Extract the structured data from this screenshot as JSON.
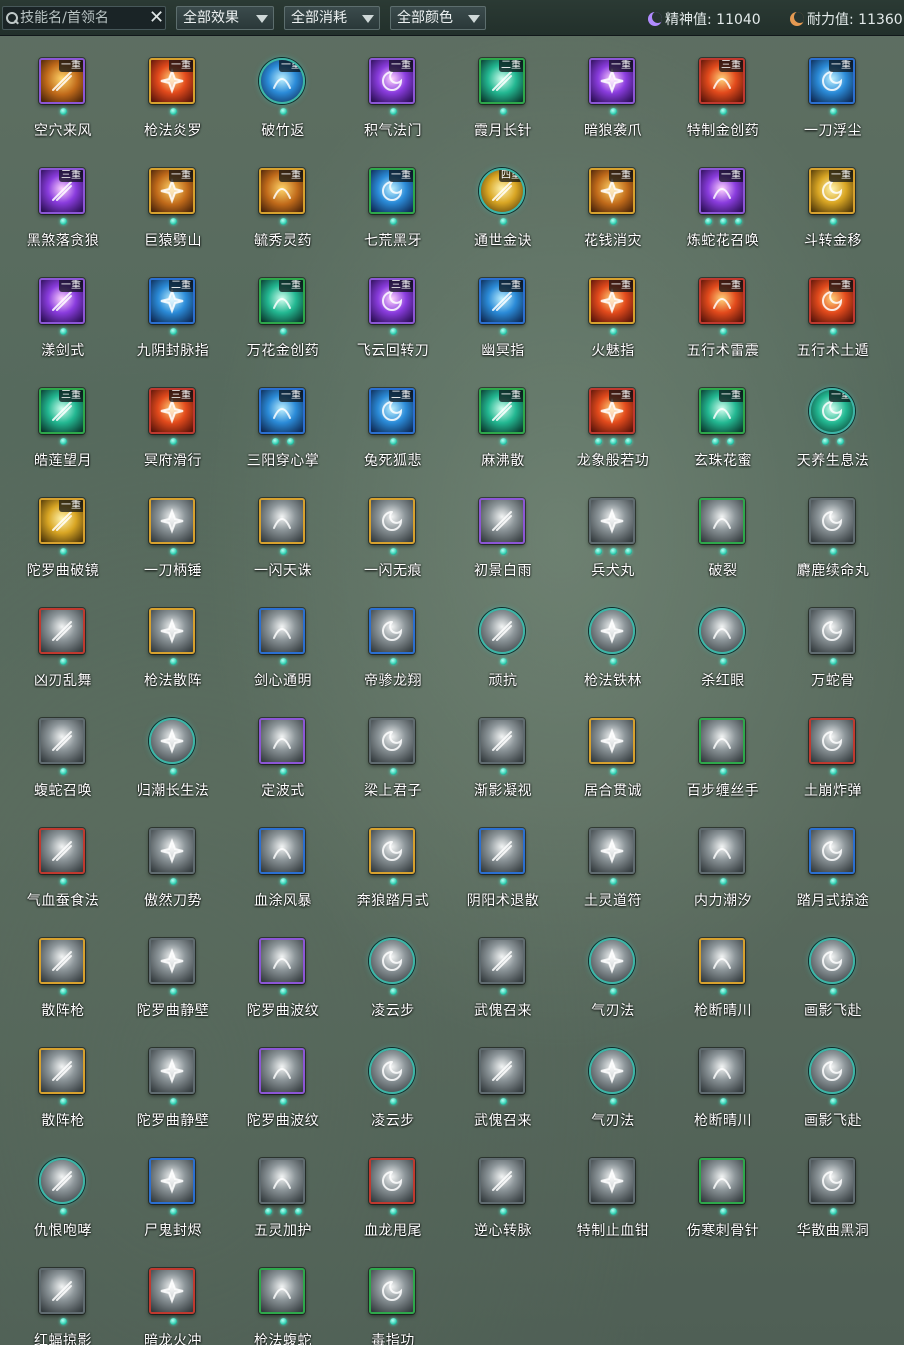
{
  "filter_bar": {
    "search_placeholder": "技能名/首领名",
    "effect_select": "全部效果",
    "cost_select": "全部消耗",
    "color_select": "全部颜色",
    "spirit": "精神值: 11040",
    "stamina": "耐力值: 11360"
  },
  "colors": {
    "purple": "#8c56d6",
    "gold": "#d7a12e",
    "green": "#2ea84b",
    "blue": "#2b6fd1",
    "red": "#c0392f",
    "gray": "#606b70",
    "teal": "#3cb6a8"
  },
  "skills": [
    {
      "name": "空穴来风",
      "tier": "一重",
      "frame": "purple",
      "dots": 1,
      "tone": "warm",
      "icon": "coin-icon"
    },
    {
      "name": "枪法炎罗",
      "tier": "一重",
      "frame": "gold",
      "dots": 1,
      "tone": "fire",
      "icon": "spear-icon"
    },
    {
      "name": "破竹返",
      "tier": "一重",
      "frame": "round",
      "dots": 1,
      "tone": "blue",
      "icon": "bamboo-icon"
    },
    {
      "name": "积气法门",
      "tier": "一重",
      "frame": "purple",
      "dots": 1,
      "tone": "violet",
      "icon": "qi-icon"
    },
    {
      "name": "霞月长针",
      "tier": "二重",
      "frame": "green",
      "dots": 1,
      "tone": "teal",
      "icon": "needle-icon"
    },
    {
      "name": "暗狼袭爪",
      "tier": "一重",
      "frame": "purple",
      "dots": 1,
      "tone": "violet",
      "icon": "claw-icon"
    },
    {
      "name": "特制金创药",
      "tier": "三重",
      "frame": "red",
      "dots": 1,
      "tone": "fire",
      "icon": "potion-icon"
    },
    {
      "name": "一刀浮尘",
      "tier": "一重",
      "frame": "blue",
      "dots": 1,
      "tone": "blue",
      "icon": "blade-icon"
    },
    {
      "name": "黑煞落贪狼",
      "tier": "三重",
      "frame": "purple",
      "dots": 1,
      "tone": "violet",
      "icon": "wolf-icon"
    },
    {
      "name": "巨猿劈山",
      "tier": "一重",
      "frame": "gold",
      "dots": 1,
      "tone": "warm",
      "icon": "ape-icon"
    },
    {
      "name": "毓秀灵药",
      "tier": "一重",
      "frame": "gold",
      "dots": 1,
      "tone": "warm",
      "icon": "gourd-icon"
    },
    {
      "name": "七荒黑牙",
      "tier": "一重",
      "frame": "green",
      "dots": 1,
      "tone": "blue",
      "icon": "fang-icon"
    },
    {
      "name": "通世金诀",
      "tier": "四重",
      "frame": "round",
      "dots": 1,
      "tone": "gold",
      "icon": "scroll-icon"
    },
    {
      "name": "花钱消灾",
      "tier": "一重",
      "frame": "gold",
      "dots": 1,
      "tone": "warm",
      "icon": "pouch-icon"
    },
    {
      "name": "炼蛇花召唤",
      "tier": "一重",
      "frame": "purple",
      "dots": 3,
      "tone": "violet",
      "icon": "serpent-icon"
    },
    {
      "name": "斗转金移",
      "tier": "一重",
      "frame": "gold",
      "dots": 1,
      "tone": "gold",
      "icon": "gold-coin-icon"
    },
    {
      "name": "漾剑式",
      "tier": "一重",
      "frame": "purple",
      "dots": 1,
      "tone": "violet",
      "icon": "sword-icon"
    },
    {
      "name": "九阴封脉指",
      "tier": "二重",
      "frame": "blue",
      "dots": 1,
      "tone": "blue",
      "icon": "finger-icon"
    },
    {
      "name": "万花金创药",
      "tier": "一重",
      "frame": "green",
      "dots": 1,
      "tone": "teal",
      "icon": "herb-icon"
    },
    {
      "name": "飞云回转刀",
      "tier": "三重",
      "frame": "purple",
      "dots": 1,
      "tone": "violet",
      "icon": "saber-icon"
    },
    {
      "name": "幽冥指",
      "tier": "一重",
      "frame": "blue",
      "dots": 1,
      "tone": "blue",
      "icon": "finger-icon"
    },
    {
      "name": "火魅指",
      "tier": "一重",
      "frame": "gold",
      "dots": 1,
      "tone": "fire",
      "icon": "fire-finger-icon"
    },
    {
      "name": "五行术雷震",
      "tier": "一重",
      "frame": "red",
      "dots": 1,
      "tone": "fire",
      "icon": "thunder-icon"
    },
    {
      "name": "五行术土遁",
      "tier": "一重",
      "frame": "red",
      "dots": 1,
      "tone": "fire",
      "icon": "earth-icon"
    },
    {
      "name": "皓莲望月",
      "tier": "三重",
      "frame": "green",
      "dots": 1,
      "tone": "teal",
      "icon": "moon-icon"
    },
    {
      "name": "冥府滑行",
      "tier": "三重",
      "frame": "red",
      "dots": 1,
      "tone": "fire",
      "icon": "dash-icon"
    },
    {
      "name": "三阳穿心掌",
      "tier": "一重",
      "frame": "blue",
      "dots": 2,
      "tone": "blue",
      "icon": "palm-icon"
    },
    {
      "name": "兔死狐悲",
      "tier": "二重",
      "frame": "blue",
      "dots": 1,
      "tone": "blue",
      "icon": "fox-icon"
    },
    {
      "name": "麻沸散",
      "tier": "一重",
      "frame": "green",
      "dots": 1,
      "tone": "teal",
      "icon": "powder-icon"
    },
    {
      "name": "龙象般若功",
      "tier": "一重",
      "frame": "red",
      "dots": 3,
      "tone": "fire",
      "icon": "dragon-icon"
    },
    {
      "name": "玄珠花蜜",
      "tier": "一重",
      "frame": "green",
      "dots": 2,
      "tone": "teal",
      "icon": "flower-icon"
    },
    {
      "name": "天养生息法",
      "tier": "一重",
      "frame": "round",
      "dots": 2,
      "tone": "teal",
      "icon": "lotus-icon"
    },
    {
      "name": "陀罗曲破镜",
      "tier": "一重",
      "frame": "gold",
      "dots": 1,
      "tone": "gold",
      "icon": "mirror-icon"
    },
    {
      "name": "一刀柄锤",
      "tier": "",
      "frame": "gold",
      "dots": 1,
      "tone": "gray",
      "icon": "hammer-icon"
    },
    {
      "name": "一闪天诛",
      "tier": "",
      "frame": "gold",
      "dots": 1,
      "tone": "gray",
      "icon": "slash-icon"
    },
    {
      "name": "一闪无痕",
      "tier": "",
      "frame": "gold",
      "dots": 1,
      "tone": "gray",
      "icon": "slash-icon"
    },
    {
      "name": "初景白雨",
      "tier": "",
      "frame": "purple",
      "dots": 1,
      "tone": "gray",
      "icon": "rain-icon"
    },
    {
      "name": "兵犬丸",
      "tier": "",
      "frame": "gray",
      "dots": 3,
      "tone": "gray",
      "icon": "pill-icon"
    },
    {
      "name": "破裂",
      "tier": "",
      "frame": "green",
      "dots": 1,
      "tone": "gray",
      "icon": "crack-icon"
    },
    {
      "name": "麝鹿续命丸",
      "tier": "",
      "frame": "gray",
      "dots": 1,
      "tone": "gray",
      "icon": "pill-icon"
    },
    {
      "name": "凶刃乱舞",
      "tier": "",
      "frame": "red",
      "dots": 1,
      "tone": "gray",
      "icon": "blade-dance-icon"
    },
    {
      "name": "枪法散阵",
      "tier": "",
      "frame": "gold",
      "dots": 1,
      "tone": "gray",
      "icon": "spear-icon"
    },
    {
      "name": "剑心通明",
      "tier": "",
      "frame": "blue",
      "dots": 1,
      "tone": "gray",
      "icon": "sword-icon"
    },
    {
      "name": "帝骖龙翔",
      "tier": "",
      "frame": "blue",
      "dots": 1,
      "tone": "gray",
      "icon": "dragon-icon"
    },
    {
      "name": "顽抗",
      "tier": "",
      "frame": "round",
      "dots": 1,
      "tone": "gray",
      "icon": "shield-icon"
    },
    {
      "name": "枪法铁林",
      "tier": "",
      "frame": "round",
      "dots": 1,
      "tone": "gray",
      "icon": "spear-icon"
    },
    {
      "name": "杀红眼",
      "tier": "",
      "frame": "round",
      "dots": 1,
      "tone": "gray",
      "icon": "warrior-icon"
    },
    {
      "name": "万蛇骨",
      "tier": "",
      "frame": "gray",
      "dots": 1,
      "tone": "gray",
      "icon": "serpent-icon"
    },
    {
      "name": "蝮蛇召唤",
      "tier": "",
      "frame": "gray",
      "dots": 1,
      "tone": "gray",
      "icon": "serpent-icon"
    },
    {
      "name": "归潮长生法",
      "tier": "",
      "frame": "round",
      "dots": 1,
      "tone": "gray",
      "icon": "tide-icon"
    },
    {
      "name": "定波式",
      "tier": "",
      "frame": "purple",
      "dots": 1,
      "tone": "gray",
      "icon": "wave-icon"
    },
    {
      "name": "梁上君子",
      "tier": "",
      "frame": "gray",
      "dots": 1,
      "tone": "gray",
      "icon": "thief-icon"
    },
    {
      "name": "渐影凝视",
      "tier": "",
      "frame": "gray",
      "dots": 1,
      "tone": "gray",
      "icon": "eye-icon"
    },
    {
      "name": "居合贯诚",
      "tier": "",
      "frame": "gold",
      "dots": 1,
      "tone": "gray",
      "icon": "iai-icon"
    },
    {
      "name": "百步缠丝手",
      "tier": "",
      "frame": "green",
      "dots": 1,
      "tone": "gray",
      "icon": "hand-icon"
    },
    {
      "name": "土崩炸弹",
      "tier": "",
      "frame": "red",
      "dots": 1,
      "tone": "gray",
      "icon": "bomb-icon"
    },
    {
      "name": "气血蚕食法",
      "tier": "",
      "frame": "red",
      "dots": 1,
      "tone": "gray",
      "icon": "blood-icon"
    },
    {
      "name": "傲然刀势",
      "tier": "",
      "frame": "gray",
      "dots": 1,
      "tone": "gray",
      "icon": "saber-icon"
    },
    {
      "name": "血涂风暴",
      "tier": "",
      "frame": "blue",
      "dots": 1,
      "tone": "gray",
      "icon": "storm-icon"
    },
    {
      "name": "奔狼踏月式",
      "tier": "",
      "frame": "gold",
      "dots": 1,
      "tone": "gray",
      "icon": "wolf-icon"
    },
    {
      "name": "阴阳术退散",
      "tier": "",
      "frame": "blue",
      "dots": 1,
      "tone": "gray",
      "icon": "yinyang-icon"
    },
    {
      "name": "土灵道符",
      "tier": "",
      "frame": "gray",
      "dots": 1,
      "tone": "gray",
      "icon": "talisman-icon"
    },
    {
      "name": "内力潮汐",
      "tier": "",
      "frame": "gray",
      "dots": 1,
      "tone": "gray",
      "icon": "tide-icon"
    },
    {
      "name": "踏月式掠途",
      "tier": "",
      "frame": "blue",
      "dots": 1,
      "tone": "gray",
      "icon": "moon-step-icon"
    },
    {
      "name": "散阵枪",
      "tier": "",
      "frame": "gold",
      "dots": 1,
      "tone": "gray",
      "icon": "spear-icon"
    },
    {
      "name": "陀罗曲静壁",
      "tier": "",
      "frame": "gray",
      "dots": 1,
      "tone": "gray",
      "icon": "dancer-icon"
    },
    {
      "name": "陀罗曲波纹",
      "tier": "",
      "frame": "purple",
      "dots": 1,
      "tone": "gray",
      "icon": "dancer-icon"
    },
    {
      "name": "凌云步",
      "tier": "",
      "frame": "round",
      "dots": 1,
      "tone": "gray",
      "icon": "step-icon"
    },
    {
      "name": "武傀召来",
      "tier": "",
      "frame": "gray",
      "dots": 1,
      "tone": "gray",
      "icon": "puppet-icon"
    },
    {
      "name": "气刃法",
      "tier": "",
      "frame": "round",
      "dots": 1,
      "tone": "gray",
      "icon": "wind-blade-icon"
    },
    {
      "name": "枪断晴川",
      "tier": "",
      "frame": "gold",
      "dots": 1,
      "tone": "gray",
      "icon": "spear-icon"
    },
    {
      "name": "画影飞赴",
      "tier": "",
      "frame": "round",
      "dots": 1,
      "tone": "gray",
      "icon": "cross-blade-icon"
    },
    {
      "name": "散阵枪",
      "tier": "",
      "frame": "gold",
      "dots": 1,
      "tone": "gray",
      "icon": "spear-icon"
    },
    {
      "name": "陀罗曲静壁",
      "tier": "",
      "frame": "gray",
      "dots": 1,
      "tone": "gray",
      "icon": "dancer-icon"
    },
    {
      "name": "陀罗曲波纹",
      "tier": "",
      "frame": "purple",
      "dots": 1,
      "tone": "gray",
      "icon": "dancer-icon"
    },
    {
      "name": "凌云步",
      "tier": "",
      "frame": "round",
      "dots": 1,
      "tone": "gray",
      "icon": "step-icon"
    },
    {
      "name": "武傀召来",
      "tier": "",
      "frame": "gray",
      "dots": 1,
      "tone": "gray",
      "icon": "puppet-icon"
    },
    {
      "name": "气刃法",
      "tier": "",
      "frame": "round",
      "dots": 1,
      "tone": "gray",
      "icon": "wind-blade-icon"
    },
    {
      "name": "枪断晴川",
      "tier": "",
      "frame": "gray",
      "dots": 1,
      "tone": "gray",
      "icon": "spear-icon"
    },
    {
      "name": "画影飞赴",
      "tier": "",
      "frame": "round",
      "dots": 1,
      "tone": "gray",
      "icon": "cross-blade-icon"
    },
    {
      "name": "仇恨咆哮",
      "tier": "",
      "frame": "round",
      "dots": 1,
      "tone": "gray",
      "icon": "roar-icon"
    },
    {
      "name": "尸鬼封烬",
      "tier": "",
      "frame": "blue",
      "dots": 1,
      "tone": "gray",
      "icon": "ghost-icon"
    },
    {
      "name": "五灵加护",
      "tier": "",
      "frame": "gray",
      "dots": 3,
      "tone": "gray",
      "icon": "ward-icon"
    },
    {
      "name": "血龙甩尾",
      "tier": "",
      "frame": "red",
      "dots": 1,
      "tone": "gray",
      "icon": "dragon-tail-icon"
    },
    {
      "name": "逆心转脉",
      "tier": "",
      "frame": "gray",
      "dots": 1,
      "tone": "gray",
      "icon": "meridian-icon"
    },
    {
      "name": "特制止血钳",
      "tier": "",
      "frame": "gray",
      "dots": 1,
      "tone": "gray",
      "icon": "clamp-icon"
    },
    {
      "name": "伤寒刺骨针",
      "tier": "",
      "frame": "green",
      "dots": 1,
      "tone": "gray",
      "icon": "needle-icon"
    },
    {
      "name": "华散曲黑洞",
      "tier": "",
      "frame": "gray",
      "dots": 1,
      "tone": "gray",
      "icon": "black-hole-icon"
    },
    {
      "name": "红蝠掠影",
      "tier": "",
      "frame": "gray",
      "dots": 1,
      "tone": "gray",
      "icon": "bat-icon"
    },
    {
      "name": "暗龙火冲",
      "tier": "",
      "frame": "red",
      "dots": 1,
      "tone": "gray",
      "icon": "dragon-icon"
    },
    {
      "name": "枪法蝮蛇",
      "tier": "",
      "frame": "green",
      "dots": 1,
      "tone": "gray",
      "icon": "spear-icon"
    },
    {
      "name": "毒指功",
      "tier": "",
      "frame": "green",
      "dots": 1,
      "tone": "gray",
      "icon": "poison-finger-icon"
    }
  ]
}
